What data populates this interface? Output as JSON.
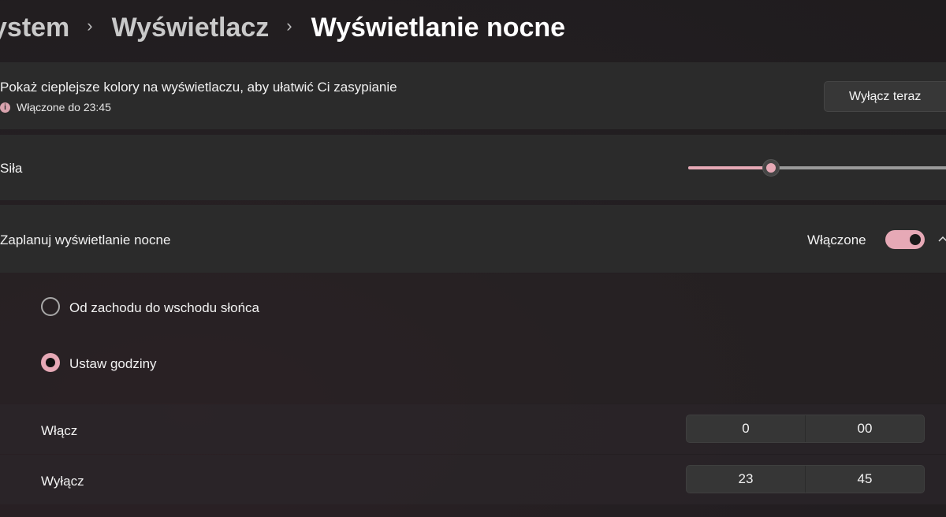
{
  "breadcrumb": {
    "items": [
      "System",
      "Wyświetlacz"
    ],
    "visible_first": "ystem",
    "second": "Wyświetlacz",
    "current": "Wyświetlanie nocne",
    "separator": "›"
  },
  "status": {
    "title": "Pokaż cieplejsze kolory na wyświetlaczu, aby ułatwić Ci zasypianie",
    "subtitle": "Włączone do 23:45",
    "button_label": "Wyłącz teraz"
  },
  "strength": {
    "label": "Siła",
    "value_fraction": 0.31
  },
  "schedule": {
    "label": "Zaplanuj wyświetlanie nocne",
    "toggle_state_label": "Włączone",
    "toggle_on": true,
    "expanded": true,
    "options": [
      {
        "label": "Od zachodu do wschodu słońca",
        "selected": false
      },
      {
        "label": "Ustaw godziny",
        "selected": true
      }
    ],
    "turn_on": {
      "label": "Włącz",
      "hour": "0",
      "minute": "00"
    },
    "turn_off": {
      "label": "Wyłącz",
      "hour": "23",
      "minute": "45"
    }
  },
  "colors": {
    "accent": "#e6a9b6",
    "card": "#2b2b2b",
    "background": "#201c1e"
  },
  "icons": [
    "chevron-right-icon",
    "info-icon",
    "chevron-up-icon"
  ]
}
